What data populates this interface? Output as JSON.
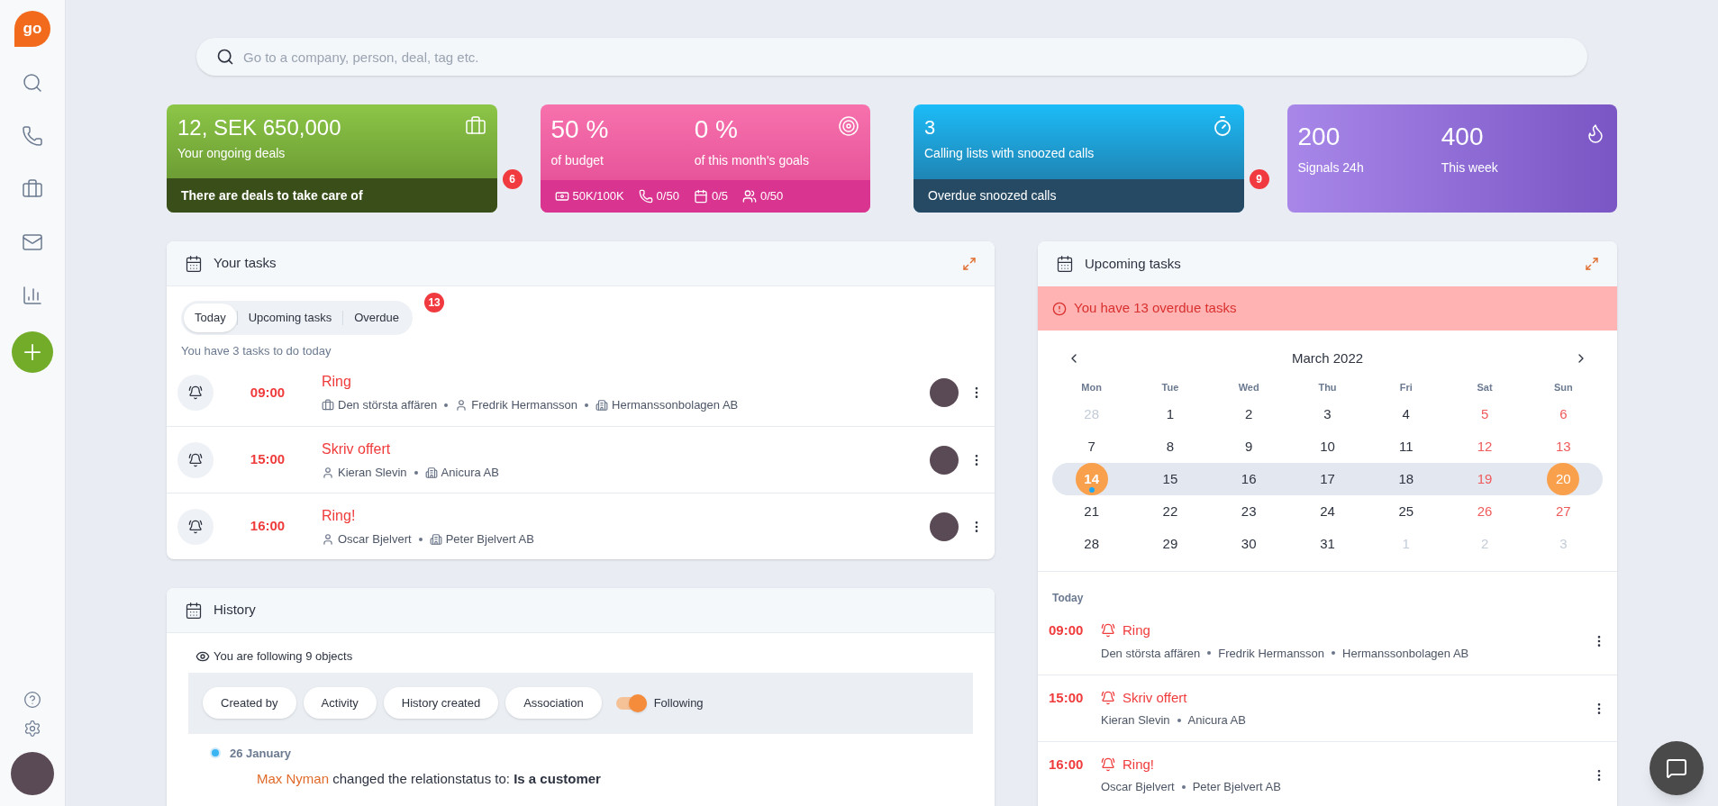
{
  "logo": "go",
  "search": {
    "placeholder": "Go to a company, person, deal, tag etc."
  },
  "deals_card": {
    "value": "12, SEK 650,000",
    "label": "Your ongoing deals",
    "footer": "There are deals to take care of",
    "badge": "6"
  },
  "goals_card": {
    "stats": [
      {
        "value": "50 %",
        "label": "of budget"
      },
      {
        "value": "0 %",
        "label": "of this month's goals"
      }
    ],
    "footer": [
      {
        "kind": "money",
        "text": "50K/100K"
      },
      {
        "kind": "phone",
        "text": "0/50"
      },
      {
        "kind": "calendar",
        "text": "0/5"
      },
      {
        "kind": "meeting",
        "text": "0/50"
      }
    ]
  },
  "calls_card": {
    "value": "3",
    "label": "Calling lists with snoozed calls",
    "footer": "Overdue snoozed calls",
    "badge": "9"
  },
  "signals_card": {
    "stats": [
      {
        "value": "200",
        "label": "Signals 24h"
      },
      {
        "value": "400",
        "label": "This week"
      }
    ]
  },
  "your_tasks": {
    "title": "Your tasks",
    "tabs": [
      {
        "label": "Today",
        "selected": true
      },
      {
        "label": "Upcoming tasks",
        "selected": false
      },
      {
        "label": "Overdue",
        "selected": false,
        "badge": "13"
      }
    ],
    "summary": "You have 3 tasks to do today",
    "rows": [
      {
        "time": "09:00",
        "title": "Ring",
        "meta": [
          {
            "kind": "deal",
            "text": "Den största affären"
          },
          {
            "kind": "person",
            "text": "Fredrik Hermansson"
          },
          {
            "kind": "company",
            "text": "Hermanssonbolagen AB"
          }
        ]
      },
      {
        "time": "15:00",
        "title": "Skriv offert",
        "meta": [
          {
            "kind": "person",
            "text": "Kieran Slevin"
          },
          {
            "kind": "company",
            "text": "Anicura AB"
          }
        ]
      },
      {
        "time": "16:00",
        "title": "Ring!",
        "meta": [
          {
            "kind": "person",
            "text": "Oscar Bjelvert"
          },
          {
            "kind": "company",
            "text": "Peter Bjelvert AB"
          }
        ]
      }
    ]
  },
  "history": {
    "title": "History",
    "following_text": "You are following 9 objects",
    "filters": [
      "Created by",
      "Activity",
      "History created",
      "Association"
    ],
    "toggle": {
      "label": "Following",
      "on": true
    },
    "date": "26 January",
    "entry": {
      "actor": "Max Nyman",
      "text": "changed the relationstatus to: **Is a customer**"
    }
  },
  "upcoming": {
    "title": "Upcoming tasks",
    "alert": "You have 13 overdue tasks",
    "month": "March 2022",
    "weekdays": [
      "Mon",
      "Tue",
      "Wed",
      "Thu",
      "Fri",
      "Sat",
      "Sun"
    ],
    "weeks": [
      {
        "selected": false,
        "days": [
          {
            "label": "28",
            "muted": true,
            "weekend": false,
            "circled": false,
            "dot": false
          },
          {
            "label": "1",
            "muted": false,
            "weekend": false,
            "circled": false,
            "dot": false
          },
          {
            "label": "2",
            "muted": false,
            "weekend": false,
            "circled": false,
            "dot": false
          },
          {
            "label": "3",
            "muted": false,
            "weekend": false,
            "circled": false,
            "dot": false
          },
          {
            "label": "4",
            "muted": false,
            "weekend": false,
            "circled": false,
            "dot": false
          },
          {
            "label": "5",
            "muted": false,
            "weekend": true,
            "circled": false,
            "dot": false
          },
          {
            "label": "6",
            "muted": false,
            "weekend": true,
            "circled": false,
            "dot": false
          }
        ]
      },
      {
        "selected": false,
        "days": [
          {
            "label": "7",
            "muted": false,
            "weekend": false,
            "circled": false,
            "dot": false
          },
          {
            "label": "8",
            "muted": false,
            "weekend": false,
            "circled": false,
            "dot": false
          },
          {
            "label": "9",
            "muted": false,
            "weekend": false,
            "circled": false,
            "dot": false
          },
          {
            "label": "10",
            "muted": false,
            "weekend": false,
            "circled": false,
            "dot": false
          },
          {
            "label": "11",
            "muted": false,
            "weekend": false,
            "circled": false,
            "dot": false
          },
          {
            "label": "12",
            "muted": false,
            "weekend": true,
            "circled": false,
            "dot": false
          },
          {
            "label": "13",
            "muted": false,
            "weekend": true,
            "circled": false,
            "dot": false
          }
        ]
      },
      {
        "selected": true,
        "days": [
          {
            "label": "14",
            "muted": false,
            "weekend": false,
            "circled": true,
            "dot": true
          },
          {
            "label": "15",
            "muted": false,
            "weekend": false,
            "circled": false,
            "dot": false
          },
          {
            "label": "16",
            "muted": false,
            "weekend": false,
            "circled": false,
            "dot": false
          },
          {
            "label": "17",
            "muted": false,
            "weekend": false,
            "circled": false,
            "dot": false
          },
          {
            "label": "18",
            "muted": false,
            "weekend": false,
            "circled": false,
            "dot": false
          },
          {
            "label": "19",
            "muted": false,
            "weekend": true,
            "circled": false,
            "dot": false
          },
          {
            "label": "20",
            "muted": false,
            "weekend": true,
            "circled": true,
            "dot": false
          }
        ]
      },
      {
        "selected": false,
        "days": [
          {
            "label": "21",
            "muted": false,
            "weekend": false,
            "circled": false,
            "dot": false
          },
          {
            "label": "22",
            "muted": false,
            "weekend": false,
            "circled": false,
            "dot": false
          },
          {
            "label": "23",
            "muted": false,
            "weekend": false,
            "circled": false,
            "dot": false
          },
          {
            "label": "24",
            "muted": false,
            "weekend": false,
            "circled": false,
            "dot": false
          },
          {
            "label": "25",
            "muted": false,
            "weekend": false,
            "circled": false,
            "dot": false
          },
          {
            "label": "26",
            "muted": false,
            "weekend": true,
            "circled": false,
            "dot": false
          },
          {
            "label": "27",
            "muted": false,
            "weekend": true,
            "circled": false,
            "dot": false
          }
        ]
      },
      {
        "selected": false,
        "days": [
          {
            "label": "28",
            "muted": false,
            "weekend": false,
            "circled": false,
            "dot": false
          },
          {
            "label": "29",
            "muted": false,
            "weekend": false,
            "circled": false,
            "dot": false
          },
          {
            "label": "30",
            "muted": false,
            "weekend": false,
            "circled": false,
            "dot": false
          },
          {
            "label": "31",
            "muted": false,
            "weekend": false,
            "circled": false,
            "dot": false
          },
          {
            "label": "1",
            "muted": true,
            "weekend": false,
            "circled": false,
            "dot": false
          },
          {
            "label": "2",
            "muted": true,
            "weekend": false,
            "circled": false,
            "dot": false
          },
          {
            "label": "3",
            "muted": true,
            "weekend": false,
            "circled": false,
            "dot": false
          }
        ]
      }
    ],
    "section": "Today",
    "rows": [
      {
        "time": "09:00",
        "title": "Ring",
        "meta": [
          "Den största affären",
          "Fredrik Hermansson",
          "Hermanssonbolagen AB"
        ]
      },
      {
        "time": "15:00",
        "title": "Skriv offert",
        "meta": [
          "Kieran Slevin",
          "Anicura AB"
        ]
      },
      {
        "time": "16:00",
        "title": "Ring!",
        "meta": [
          "Oscar Bjelvert",
          "Peter Bjelvert AB"
        ]
      }
    ]
  }
}
